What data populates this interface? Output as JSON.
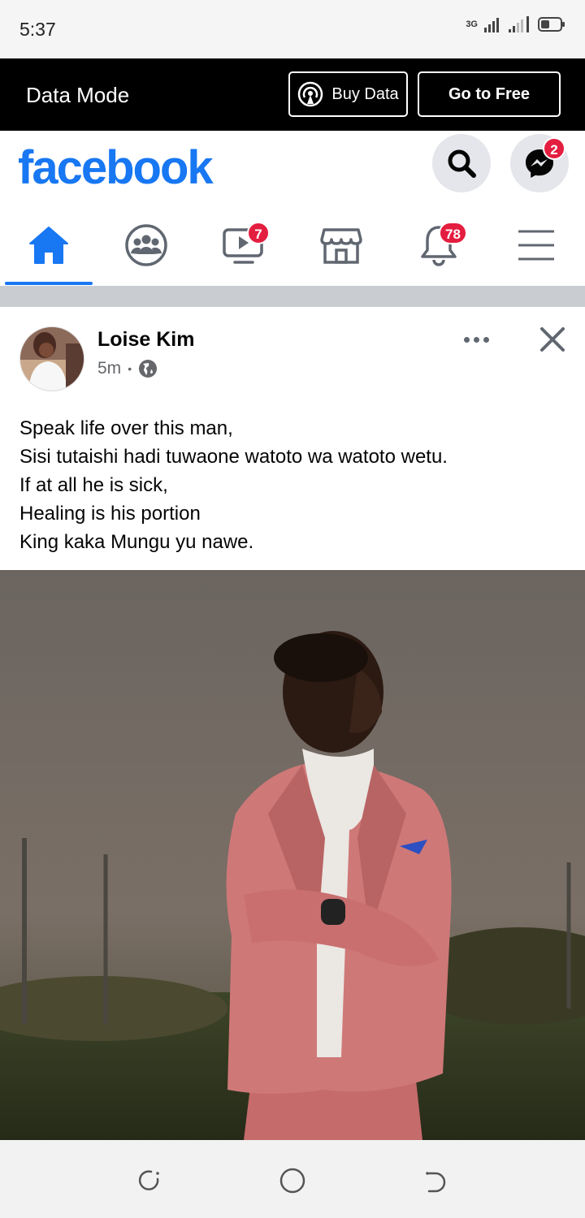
{
  "status_bar": {
    "time": "5:37",
    "network": "3G"
  },
  "data_mode_bar": {
    "title": "Data Mode",
    "buy_label": "Buy Data",
    "free_label": "Go to Free"
  },
  "header": {
    "logo": "facebook",
    "messenger_badge": "2",
    "brand_color": "#1877f2"
  },
  "nav": {
    "tabs": [
      {
        "name": "home-icon",
        "badge": ""
      },
      {
        "name": "groups-icon",
        "badge": ""
      },
      {
        "name": "watch-icon",
        "badge": "7"
      },
      {
        "name": "marketplace-icon",
        "badge": ""
      },
      {
        "name": "bell-icon",
        "badge": "78"
      },
      {
        "name": "menu-icon",
        "badge": ""
      }
    ],
    "active_tab": "home"
  },
  "post": {
    "author": "Loise Kim",
    "time": "5m",
    "separator": "•",
    "audience_icon": "globe-icon",
    "text_lines": [
      "Speak life over this man,",
      "Sisi tutaishi hadi tuwaone watoto wa watoto wetu.",
      "If at all he is sick,",
      "Healing is his portion",
      "King kaka Mungu yu nawe."
    ]
  },
  "colors": {
    "badge": "#e41e3f",
    "divider": "#c9ccd1",
    "data_bar": "#000000"
  }
}
